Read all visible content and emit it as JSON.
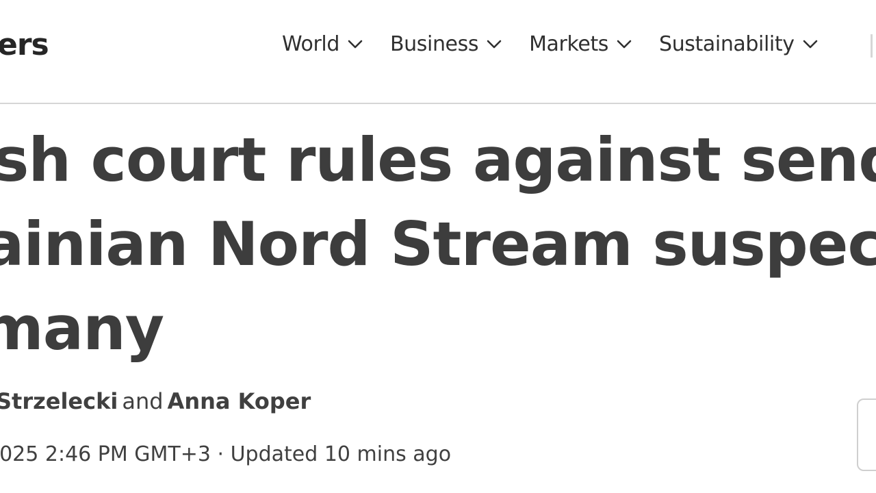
{
  "header": {
    "logo_text": "ers",
    "nav": [
      {
        "label": "World",
        "icon": "chevron-down-icon"
      },
      {
        "label": "Business",
        "icon": "chevron-down-icon"
      },
      {
        "label": "Markets",
        "icon": "chevron-down-icon"
      },
      {
        "label": "Sustainability",
        "icon": "chevron-down-icon"
      }
    ]
  },
  "article": {
    "headline_lines": [
      "sh court rules against sending",
      "ainian Nord Stream suspect to",
      "many"
    ],
    "byline": {
      "author1": "Strzelecki",
      "connector": "and",
      "author2": "Anna Koper"
    },
    "dateline": "2025 2:46 PM GMT+3 · Updated 10 mins ago"
  }
}
